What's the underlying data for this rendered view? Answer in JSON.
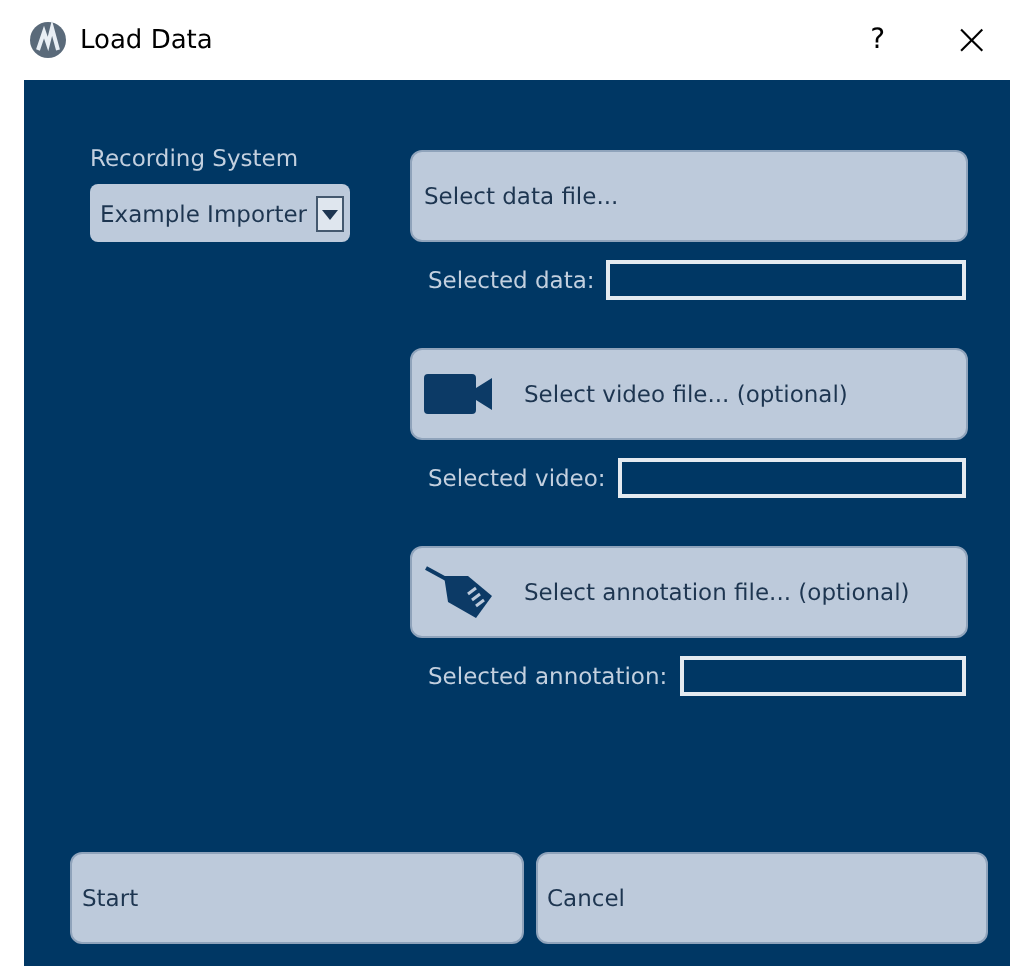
{
  "window": {
    "title": "Load Data",
    "help": "?",
    "close": "×"
  },
  "recording_system": {
    "label": "Recording System",
    "value": "Example Importer"
  },
  "sections": [
    {
      "kind": "data",
      "button": "Select data file...",
      "field_label": "Selected data:"
    },
    {
      "kind": "video",
      "button": "Select video file... (optional)",
      "field_label": "Selected video:"
    },
    {
      "kind": "annotation",
      "button": "Select annotation file... (optional)",
      "field_label": "Selected annotation:"
    }
  ],
  "buttons": [
    "Start",
    "Cancel"
  ]
}
